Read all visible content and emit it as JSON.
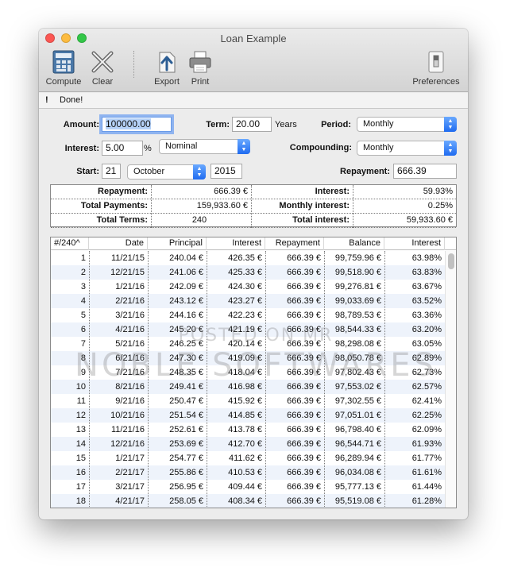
{
  "window": {
    "title": "Loan Example"
  },
  "toolbar": {
    "compute_label": "Compute",
    "clear_label": "Clear",
    "export_label": "Export",
    "print_label": "Print",
    "preferences_label": "Preferences"
  },
  "status": {
    "icon": "!",
    "message": "Done!"
  },
  "form": {
    "amount_label": "Amount:",
    "amount_value": "100000.00",
    "term_label": "Term:",
    "term_value": "20.00",
    "term_unit": "Years",
    "period_label": "Period:",
    "period_value": "Monthly",
    "interest_label": "Interest:",
    "interest_value": "5.00",
    "interest_unit": "%",
    "interest_type_value": "Nominal",
    "compounding_label": "Compounding:",
    "compounding_value": "Monthly",
    "start_label": "Start:",
    "start_day": "21",
    "start_month": "October",
    "start_year": "2015",
    "repayment_label": "Repayment:",
    "repayment_value": "666.39"
  },
  "summary": {
    "rows": [
      {
        "l1": "Repayment:",
        "v1": "666.39 €",
        "l2": "Interest:",
        "v2": "59.93%"
      },
      {
        "l1": "Total Payments:",
        "v1": "159,933.60 €",
        "l2": "Monthly interest:",
        "v2": "0.25%"
      },
      {
        "l1": "Total Terms:",
        "v1": "240",
        "l2": "Total interest:",
        "v2": "59,933.60 €"
      }
    ]
  },
  "table": {
    "headers": [
      "#/240^",
      "Date",
      "Principal",
      "Interest",
      "Repayment",
      "Balance",
      "Interest"
    ],
    "rows": [
      [
        "1",
        "11/21/15",
        "240.04 €",
        "426.35 €",
        "666.39 €",
        "99,759.96 €",
        "63.98%"
      ],
      [
        "2",
        "12/21/15",
        "241.06 €",
        "425.33 €",
        "666.39 €",
        "99,518.90 €",
        "63.83%"
      ],
      [
        "3",
        "1/21/16",
        "242.09 €",
        "424.30 €",
        "666.39 €",
        "99,276.81 €",
        "63.67%"
      ],
      [
        "4",
        "2/21/16",
        "243.12 €",
        "423.27 €",
        "666.39 €",
        "99,033.69 €",
        "63.52%"
      ],
      [
        "5",
        "3/21/16",
        "244.16 €",
        "422.23 €",
        "666.39 €",
        "98,789.53 €",
        "63.36%"
      ],
      [
        "6",
        "4/21/16",
        "245.20 €",
        "421.19 €",
        "666.39 €",
        "98,544.33 €",
        "63.20%"
      ],
      [
        "7",
        "5/21/16",
        "246.25 €",
        "420.14 €",
        "666.39 €",
        "98,298.08 €",
        "63.05%"
      ],
      [
        "8",
        "6/21/16",
        "247.30 €",
        "419.09 €",
        "666.39 €",
        "98,050.78 €",
        "62.89%"
      ],
      [
        "9",
        "7/21/16",
        "248.35 €",
        "418.04 €",
        "666.39 €",
        "97,802.43 €",
        "62.73%"
      ],
      [
        "10",
        "8/21/16",
        "249.41 €",
        "416.98 €",
        "666.39 €",
        "97,553.02 €",
        "62.57%"
      ],
      [
        "11",
        "9/21/16",
        "250.47 €",
        "415.92 €",
        "666.39 €",
        "97,302.55 €",
        "62.41%"
      ],
      [
        "12",
        "10/21/16",
        "251.54 €",
        "414.85 €",
        "666.39 €",
        "97,051.01 €",
        "62.25%"
      ],
      [
        "13",
        "11/21/16",
        "252.61 €",
        "413.78 €",
        "666.39 €",
        "96,798.40 €",
        "62.09%"
      ],
      [
        "14",
        "12/21/16",
        "253.69 €",
        "412.70 €",
        "666.39 €",
        "96,544.71 €",
        "61.93%"
      ],
      [
        "15",
        "1/21/17",
        "254.77 €",
        "411.62 €",
        "666.39 €",
        "96,289.94 €",
        "61.77%"
      ],
      [
        "16",
        "2/21/17",
        "255.86 €",
        "410.53 €",
        "666.39 €",
        "96,034.08 €",
        "61.61%"
      ],
      [
        "17",
        "3/21/17",
        "256.95 €",
        "409.44 €",
        "666.39 €",
        "95,777.13 €",
        "61.44%"
      ],
      [
        "18",
        "4/21/17",
        "258.05 €",
        "408.34 €",
        "666.39 €",
        "95,519.08 €",
        "61.28%"
      ]
    ]
  },
  "watermark": {
    "line1": "POSTED ON MR",
    "line2": "NOBLE SOFTWARES"
  },
  "colors": {
    "close": "#fc5753",
    "minimize": "#fdbc40",
    "zoom": "#33c748",
    "accent": "#1f6bf0"
  }
}
